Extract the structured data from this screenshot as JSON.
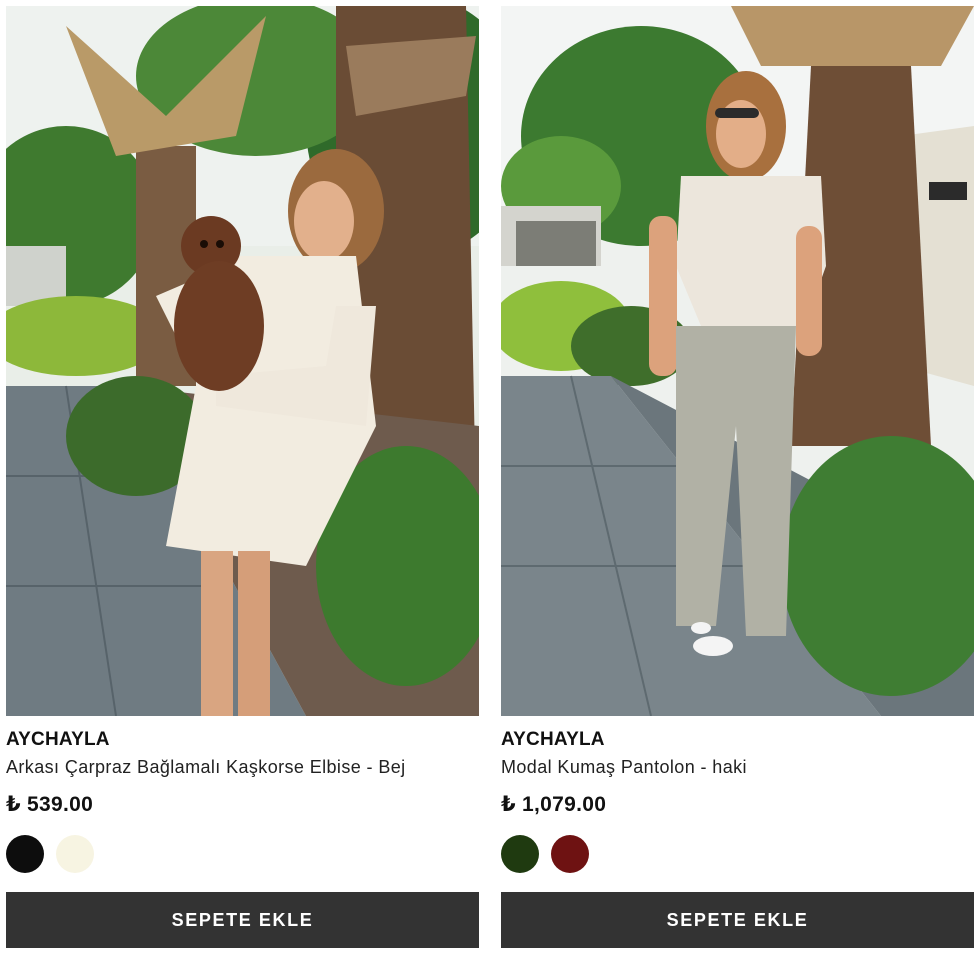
{
  "products": [
    {
      "brand": "AYCHAYLA",
      "title": "Arkası Çarpraz Bağlamalı Kaşkorse Elbise - Bej",
      "price": "₺ 539.00",
      "image_alt": "Woman in a cream knit dress holding a brown poodle in a garden with palm trees",
      "colors": [
        "#0d0d0d",
        "#f7f4e2"
      ],
      "add_to_cart_label": "SEPETE EKLE"
    },
    {
      "brand": "AYCHAYLA",
      "title": "Modal Kumaş Pantolon - haki",
      "price": "₺ 1,079.00",
      "image_alt": "Woman in a striped cropped shirt and khaki wide-leg trousers on a stone path by palm trees",
      "colors": [
        "#1f3a10",
        "#6e1212"
      ],
      "add_to_cart_label": "SEPETE EKLE"
    }
  ]
}
